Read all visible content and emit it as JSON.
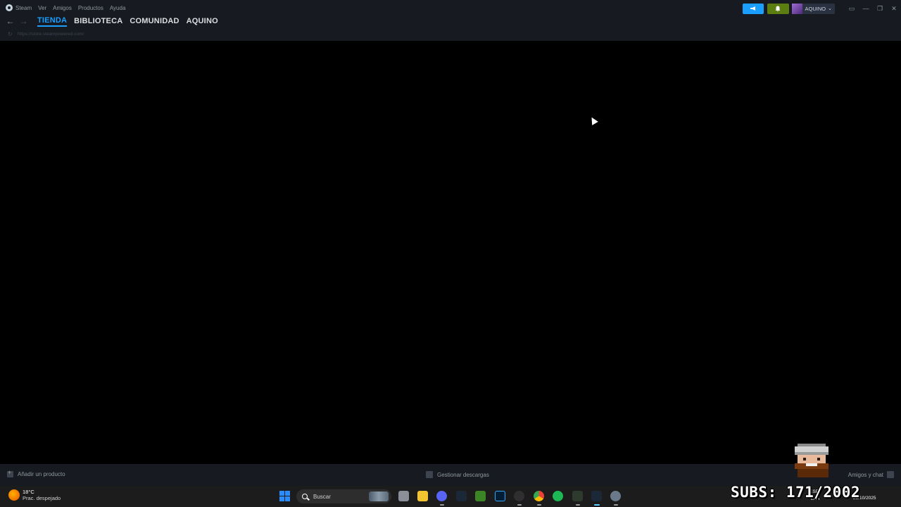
{
  "steam": {
    "menu": [
      "Steam",
      "Ver",
      "Amigos",
      "Productos",
      "Ayuda"
    ],
    "user": {
      "name": "AQUINO"
    },
    "nav": {
      "tabs": [
        {
          "label": "TIENDA",
          "active": true
        },
        {
          "label": "BIBLIOTECA",
          "active": false
        },
        {
          "label": "COMUNIDAD",
          "active": false
        },
        {
          "label": "AQUINO",
          "active": false
        }
      ],
      "url": "https://store.steampowered.com/"
    },
    "bottom": {
      "add_product": "Añadir un producto",
      "manage_downloads": "Gestionar descargas",
      "friends_chat": "Amigos y chat"
    },
    "colors": {
      "accent": "#1a9fff",
      "notification": "#5c7e10",
      "bar": "#171a21"
    }
  },
  "overlay": {
    "subs": "SUBS: 171/2002"
  },
  "taskbar": {
    "weather": {
      "temp": "18°C",
      "condition": "Prac. despejado"
    },
    "search": {
      "placeholder": "Buscar"
    },
    "apps": [
      "task-view-icon",
      "file-explorer-icon",
      "discord-icon",
      "steam-icon",
      "minecraft-icon",
      "photoshop-icon",
      "obs-icon",
      "chrome-icon",
      "spotify-icon",
      "xbox-icon",
      "steam-active-icon",
      "settings-icon"
    ],
    "tray": {
      "lang": "ESP",
      "region": "LAA",
      "date": "28/10/2025"
    }
  }
}
